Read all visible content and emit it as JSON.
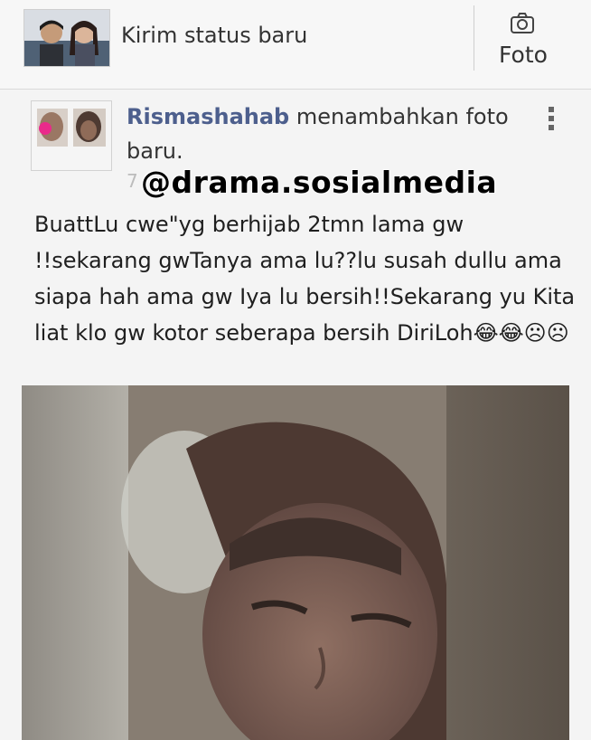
{
  "composer": {
    "placeholder": "Kirim status baru",
    "photo_label": "Foto"
  },
  "post": {
    "author": "Rismashahab",
    "action": " menambahkan foto baru.",
    "meta_visible": "7",
    "body": "BuattLu cwe\"yg berhijab 2tmn lama gw !!sekarang gwTanya ama lu??lu susah dullu ama siapa hah ama gw Iya lu bersih!!Sekarang yu Kita liat klo gw kotor seberapa bersih DiriLoh😂😂☹☹"
  },
  "watermark": "@drama.sosialmedia",
  "colors": {
    "author": "#4d5f8d",
    "background": "#f4f4f4",
    "divider": "#cfcfcf"
  },
  "icons": {
    "camera": "camera-icon",
    "more": "more-vertical-icon"
  }
}
